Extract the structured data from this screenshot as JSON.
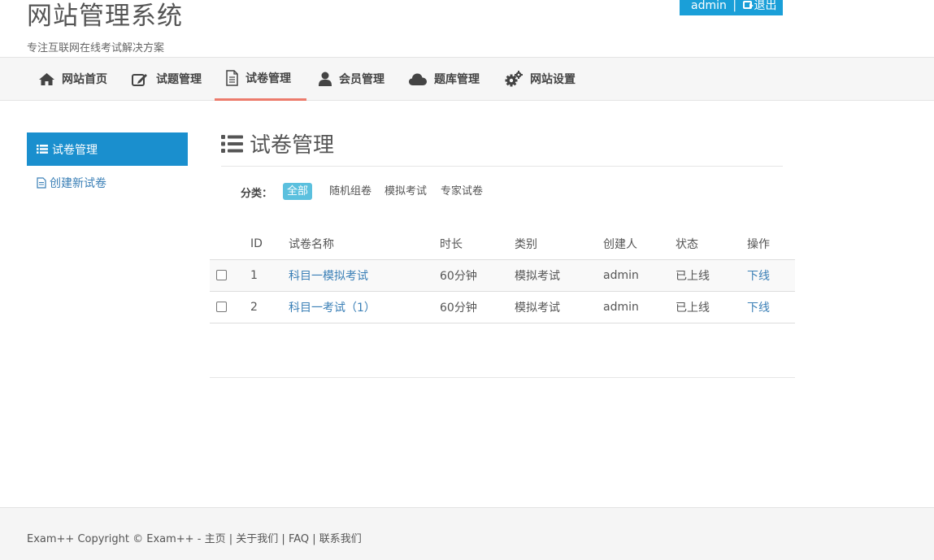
{
  "header": {
    "site_title": "网站管理系统",
    "site_subtitle": "专注互联网在线考试解决方案",
    "user_name": "admin",
    "separator": "|",
    "logout_label": "退出"
  },
  "nav": {
    "items": [
      {
        "label": "网站首页",
        "icon": "home-icon"
      },
      {
        "label": "试题管理",
        "icon": "edit-icon"
      },
      {
        "label": "试卷管理",
        "icon": "file-icon",
        "active": true
      },
      {
        "label": "会员管理",
        "icon": "user-icon"
      },
      {
        "label": "题库管理",
        "icon": "cloud-icon"
      },
      {
        "label": "网站设置",
        "icon": "cogs-icon"
      }
    ]
  },
  "sidebar": {
    "active_label": "试卷管理",
    "link_label": "创建新试卷"
  },
  "main": {
    "title": "试卷管理",
    "filter_label": "分类：",
    "filters": [
      "全部",
      "随机组卷",
      "模拟考试",
      "专家试卷"
    ],
    "active_filter": "全部"
  },
  "table": {
    "columns": [
      "ID",
      "试卷名称",
      "时长",
      "类别",
      "创建人",
      "状态",
      "操作"
    ],
    "rows": [
      {
        "id": "1",
        "name": "科目一模拟考试",
        "duration": "60分钟",
        "category": "模拟考试",
        "creator": "admin",
        "status": "已上线",
        "action": "下线"
      },
      {
        "id": "2",
        "name": "科目一考试（1）",
        "duration": "60分钟",
        "category": "模拟考试",
        "creator": "admin",
        "status": "已上线",
        "action": "下线"
      }
    ]
  },
  "footer": {
    "copyright": "Exam++ Copyright ©",
    "brand": "Exam++",
    "dash": "-",
    "links": [
      "主页",
      "关于我们",
      "FAQ",
      "联系我们"
    ],
    "separator": "|"
  },
  "colors": {
    "accent_blue": "#1a8fce",
    "nav_active_underline": "#ec7b6c",
    "filter_active": "#5bc0de",
    "link": "#3a7fb6"
  }
}
